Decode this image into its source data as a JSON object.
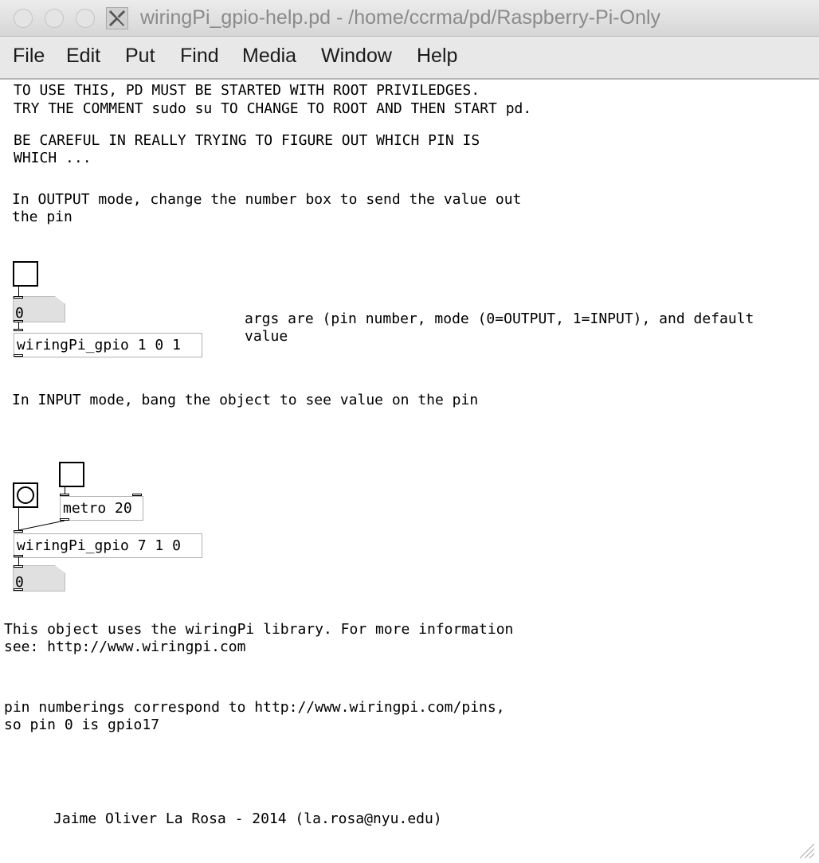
{
  "window": {
    "title": "wiringPi_gpio-help.pd  - /home/ccrma/pd/Raspberry-Pi-Only"
  },
  "menu": {
    "file": "File",
    "edit": "Edit",
    "put": "Put",
    "find": "Find",
    "media": "Media",
    "window": "Window",
    "help": "Help"
  },
  "comments": {
    "root_line1": "TO USE THIS, PD MUST BE STARTED WITH ROOT PRIVILEDGES.",
    "root_line2": "TRY THE COMMENT sudo su TO CHANGE TO ROOT AND THEN START pd.",
    "careful_line1": "BE CAREFUL IN REALLY TRYING TO FIGURE OUT WHICH PIN IS",
    "careful_line2": "WHICH ...",
    "output_line1": "In OUTPUT mode, change the number box to send the value out",
    "output_line2": "the pin",
    "args_line1": "args are (pin number, mode (0=OUTPUT, 1=INPUT), and default",
    "args_line2": "value",
    "input_line": "In INPUT mode, bang the object to see value on the pin",
    "lib_line1": "This object uses the wiringPi library. For more information",
    "lib_line2": "see: http://www.wiringpi.com",
    "pins_line1": "pin numberings correspond to http://www.wiringpi.com/pins,",
    "pins_line2": "so pin 0 is gpio17",
    "author": "Jaime Oliver La Rosa - 2014 (la.rosa@nyu.edu)"
  },
  "objects": {
    "output_numbox_value": "0",
    "output_gpio": "wiringPi_gpio 1 0 1",
    "metro": "metro 20",
    "input_gpio": "wiringPi_gpio 7 1 0",
    "input_numbox_value": "0"
  },
  "icons": {
    "close": "close-button-icon",
    "minimize": "minimize-button-icon",
    "zoom": "zoom-button-icon",
    "app": "x11-icon",
    "resize": "resize-grip-icon"
  }
}
